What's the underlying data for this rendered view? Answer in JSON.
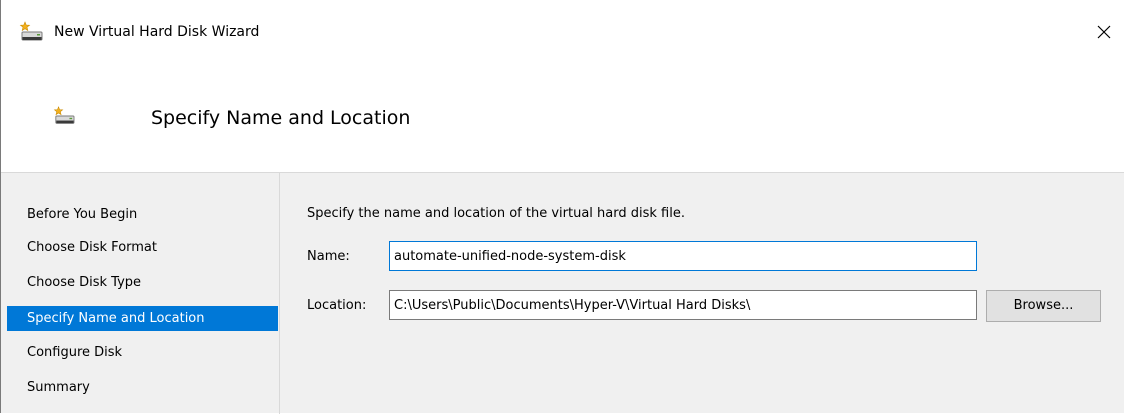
{
  "window": {
    "title": "New Virtual Hard Disk Wizard",
    "icon": "hard-disk-new-icon",
    "close_icon": "close-icon"
  },
  "header": {
    "title": "Specify Name and Location",
    "icon": "hard-disk-new-icon"
  },
  "sidebar": {
    "items": [
      {
        "label": "Before You Begin",
        "selected": false
      },
      {
        "label": "Choose Disk Format",
        "selected": false
      },
      {
        "label": "Choose Disk Type",
        "selected": false
      },
      {
        "label": "Specify Name and Location",
        "selected": true
      },
      {
        "label": "Configure Disk",
        "selected": false
      },
      {
        "label": "Summary",
        "selected": false
      }
    ]
  },
  "main": {
    "instruction": "Specify the name and location of the virtual hard disk file.",
    "name_label": "Name:",
    "name_value": "automate-unified-node-system-disk",
    "location_label": "Location:",
    "location_value": "C:\\Users\\Public\\Documents\\Hyper-V\\Virtual Hard Disks\\",
    "browse_label": "Browse..."
  },
  "colors": {
    "selection": "#0078d7",
    "panel_background": "#f0f0f0"
  }
}
